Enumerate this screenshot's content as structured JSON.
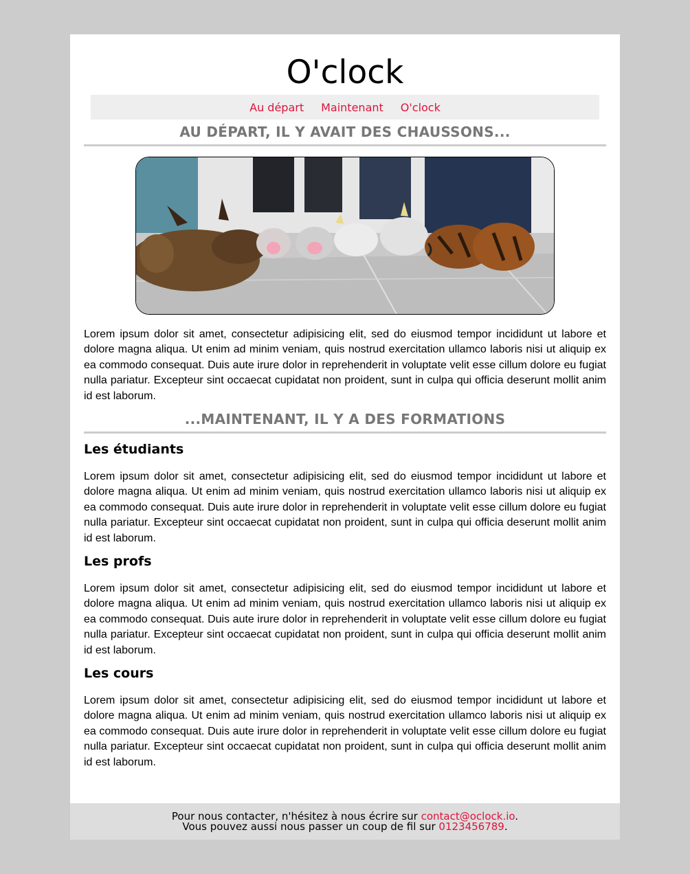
{
  "header": {
    "title": "O'clock"
  },
  "nav": {
    "items": [
      {
        "label": "Au départ"
      },
      {
        "label": "Maintenant"
      },
      {
        "label": "O'clock"
      }
    ]
  },
  "sections": {
    "depart_title": "AU DÉPART, IL Y AVAIT DES CHAUSSONS...",
    "depart_text": "Lorem ipsum dolor sit amet, consectetur adipisicing elit, sed do eiusmod tempor incididunt ut labore et dolore magna aliqua. Ut enim ad minim veniam, quis nostrud exercitation ullamco laboris nisi ut aliquip ex ea commodo consequat. Duis aute irure dolor in reprehenderit in voluptate velit esse cillum dolore eu fugiat nulla pariatur. Excepteur sint occaecat cupidatat non proident, sunt in culpa qui officia deserunt mollit anim id est laborum.",
    "maintenant_title": "...MAINTENANT, IL Y A DES FORMATIONS",
    "etudiants_title": "Les étudiants",
    "etudiants_text": "Lorem ipsum dolor sit amet, consectetur adipisicing elit, sed do eiusmod tempor incididunt ut labore et dolore magna aliqua. Ut enim ad minim veniam, quis nostrud exercitation ullamco laboris nisi ut aliquip ex ea commodo consequat. Duis aute irure dolor in reprehenderit in voluptate velit esse cillum dolore eu fugiat nulla pariatur. Excepteur sint occaecat cupidatat non proident, sunt in culpa qui officia deserunt mollit anim id est laborum.",
    "profs_title": "Les profs",
    "profs_text": "Lorem ipsum dolor sit amet, consectetur adipisicing elit, sed do eiusmod tempor incididunt ut labore et dolore magna aliqua. Ut enim ad minim veniam, quis nostrud exercitation ullamco laboris nisi ut aliquip ex ea commodo consequat. Duis aute irure dolor in reprehenderit in voluptate velit esse cillum dolore eu fugiat nulla pariatur. Excepteur sint occaecat cupidatat non proident, sunt in culpa qui officia deserunt mollit anim id est laborum.",
    "cours_title": "Les cours",
    "cours_text": "Lorem ipsum dolor sit amet, consectetur adipisicing elit, sed do eiusmod tempor incididunt ut labore et dolore magna aliqua. Ut enim ad minim veniam, quis nostrud exercitation ullamco laboris nisi ut aliquip ex ea commodo consequat. Duis aute irure dolor in reprehenderit in voluptate velit esse cillum dolore eu fugiat nulla pariatur. Excepteur sint occaecat cupidatat non proident, sunt in culpa qui officia deserunt mollit anim id est laborum."
  },
  "footer": {
    "line1_prefix": "Pour nous contacter, n'hésitez à nous écrire sur ",
    "email": "contact@oclock.io",
    "line1_suffix": ".",
    "line2_prefix": "Vous pouvez aussi nous passer un coup de fil sur ",
    "phone": "0123456789",
    "line2_suffix": "."
  },
  "colors": {
    "link": "#dc143c",
    "section_title": "#777777",
    "page_bg": "#cccccc",
    "nav_bg": "#eeeeee",
    "footer_bg": "#dddddd"
  }
}
